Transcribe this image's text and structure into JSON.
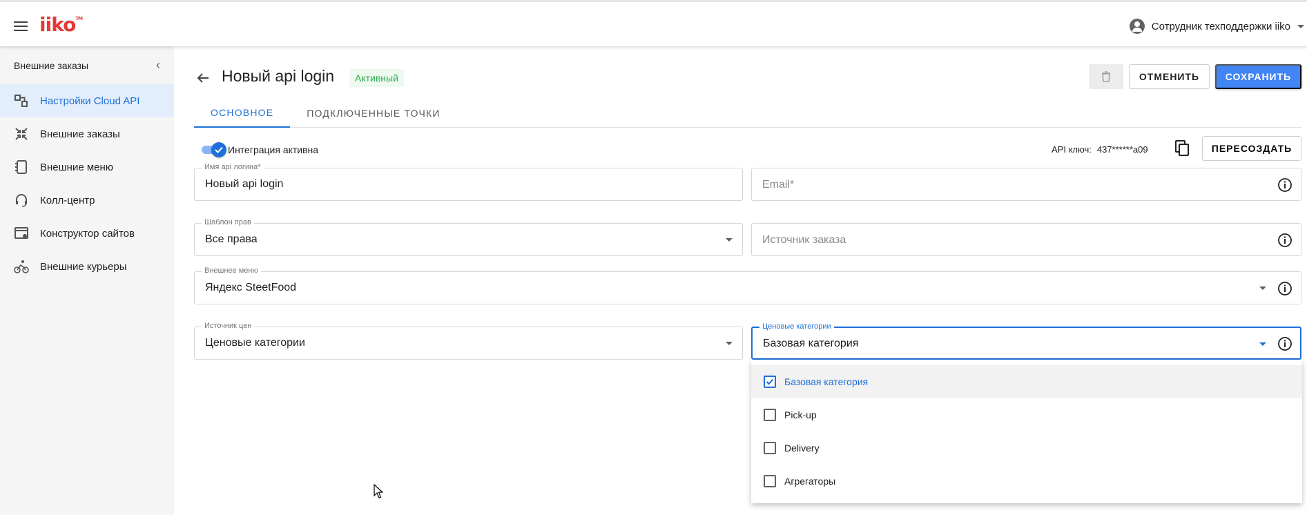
{
  "header": {
    "logo": "iiko",
    "logo_tm": "TM",
    "user_name": "Сотрудник техподдержки iiko"
  },
  "sidebar": {
    "title": "Внешние заказы",
    "items": [
      {
        "label": "Настройки Cloud API",
        "icon": "cloud-api-settings-icon",
        "active": true
      },
      {
        "label": "Внешние заказы",
        "icon": "external-orders-icon"
      },
      {
        "label": "Внешние меню",
        "icon": "external-menu-icon"
      },
      {
        "label": "Колл-центр",
        "icon": "headset-icon"
      },
      {
        "label": "Конструктор сайтов",
        "icon": "site-builder-icon"
      },
      {
        "label": "Внешние курьеры",
        "icon": "bicycle-courier-icon"
      }
    ]
  },
  "page": {
    "title": "Новый api login",
    "status": "Активный",
    "cancel_label": "ОТМЕНИТЬ",
    "save_label": "СОХРАНИТЬ",
    "tabs": [
      {
        "label": "ОСНОВНОЕ",
        "active": true
      },
      {
        "label": "ПОДКЛЮЧЕННЫЕ ТОЧКИ"
      }
    ],
    "integration_label": "Интеграция активна",
    "integration_active": true,
    "api_key_label": "API ключ:",
    "api_key_value": "437******a09",
    "recreate_label": "ПЕРЕСОЗДАТЬ"
  },
  "form": {
    "login_name": {
      "label": "Имя api логина*",
      "value": "Новый api login"
    },
    "email": {
      "placeholder": "Email*"
    },
    "rights_template": {
      "label": "Шаблон прав",
      "value": "Все права"
    },
    "order_source": {
      "placeholder": "Источник заказа"
    },
    "external_menu": {
      "label": "Внешнее меню",
      "value": "Яндекс SteetFood"
    },
    "price_source": {
      "label": "Источник цен",
      "value": "Ценовые категории"
    },
    "price_categories": {
      "label": "Ценовые категории",
      "value": "Базовая категория"
    }
  },
  "dropdown": {
    "options": [
      {
        "label": "Базовая категория",
        "checked": true
      },
      {
        "label": "Pick-up",
        "checked": false
      },
      {
        "label": "Delivery",
        "checked": false
      },
      {
        "label": "Агрегаторы",
        "checked": false
      }
    ]
  },
  "colors": {
    "accent": "#1e6fd9",
    "primary_button": "#4285f4",
    "status_green": "#2eaa4a",
    "logo_red": "#e53935"
  }
}
